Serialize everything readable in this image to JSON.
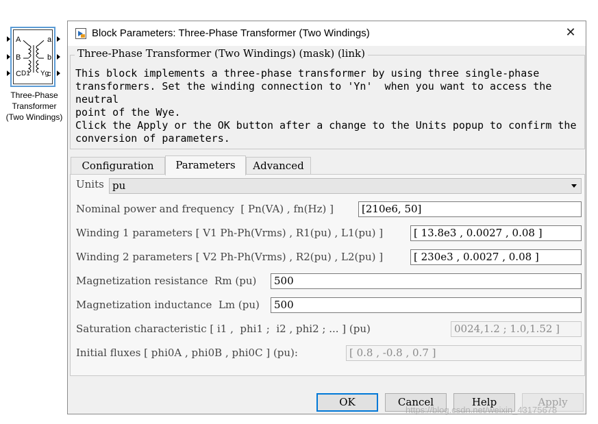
{
  "block": {
    "ports_left": [
      "A",
      "B",
      "C"
    ],
    "ports_right": [
      "a",
      "b",
      "c"
    ],
    "winding_left": "D1",
    "winding_right": "Yg",
    "caption_lines": [
      "Three-Phase",
      "Transformer",
      "(Two Windings)"
    ]
  },
  "dialog": {
    "title": "Block Parameters: Three-Phase Transformer (Two Windings)",
    "close_label": "✕",
    "mask_title": "Three-Phase Transformer (Two Windings) (mask) (link)",
    "description_1": "This block implements a three-phase transformer by using three single-phase\ntransformers. Set the winding connection to 'Yn'  when you want to access the neutral\npoint of the Wye.",
    "description_2": "Click the Apply or the OK button after a change to the Units popup to confirm the\nconversion of parameters.",
    "tabs": [
      {
        "label": "Configuration",
        "active": false
      },
      {
        "label": "Parameters",
        "active": true
      },
      {
        "label": "Advanced",
        "active": false
      }
    ],
    "units": {
      "label": "Units",
      "value": "pu"
    },
    "params": [
      {
        "label": "Nominal power and frequency  [ Pn(VA) , fn(Hz) ]",
        "value": "[210e6, 50]",
        "disabled": false
      },
      {
        "label": "Winding 1 parameters [ V1 Ph-Ph(Vrms) , R1(pu) , L1(pu) ]",
        "value": "[ 13.8e3 , 0.0027 , 0.08 ]",
        "disabled": false
      },
      {
        "label": "Winding 2 parameters [ V2 Ph-Ph(Vrms) , R2(pu) , L2(pu) ]",
        "value": "[ 230e3 , 0.0027 , 0.08 ]",
        "disabled": false
      },
      {
        "label": "Magnetization resistance  Rm (pu)",
        "value": "500",
        "disabled": false
      },
      {
        "label": "Magnetization inductance  Lm (pu)",
        "value": "500",
        "disabled": false
      },
      {
        "label": "Saturation characteristic [ i1 ,  phi1 ;  i2 , phi2 ; ... ] (pu)",
        "value": "0024,1.2 ; 1.0,1.52 ]",
        "disabled": true
      },
      {
        "label": "Initial fluxes [ phi0A , phi0B , phi0C ] (pu):",
        "value": "[ 0.8 , -0.8 , 0.7 ]",
        "disabled": true
      }
    ],
    "buttons": {
      "ok": "OK",
      "cancel": "Cancel",
      "help": "Help",
      "apply": "Apply"
    }
  },
  "watermark": "https://blog.csdn.net/weixin_43175678"
}
